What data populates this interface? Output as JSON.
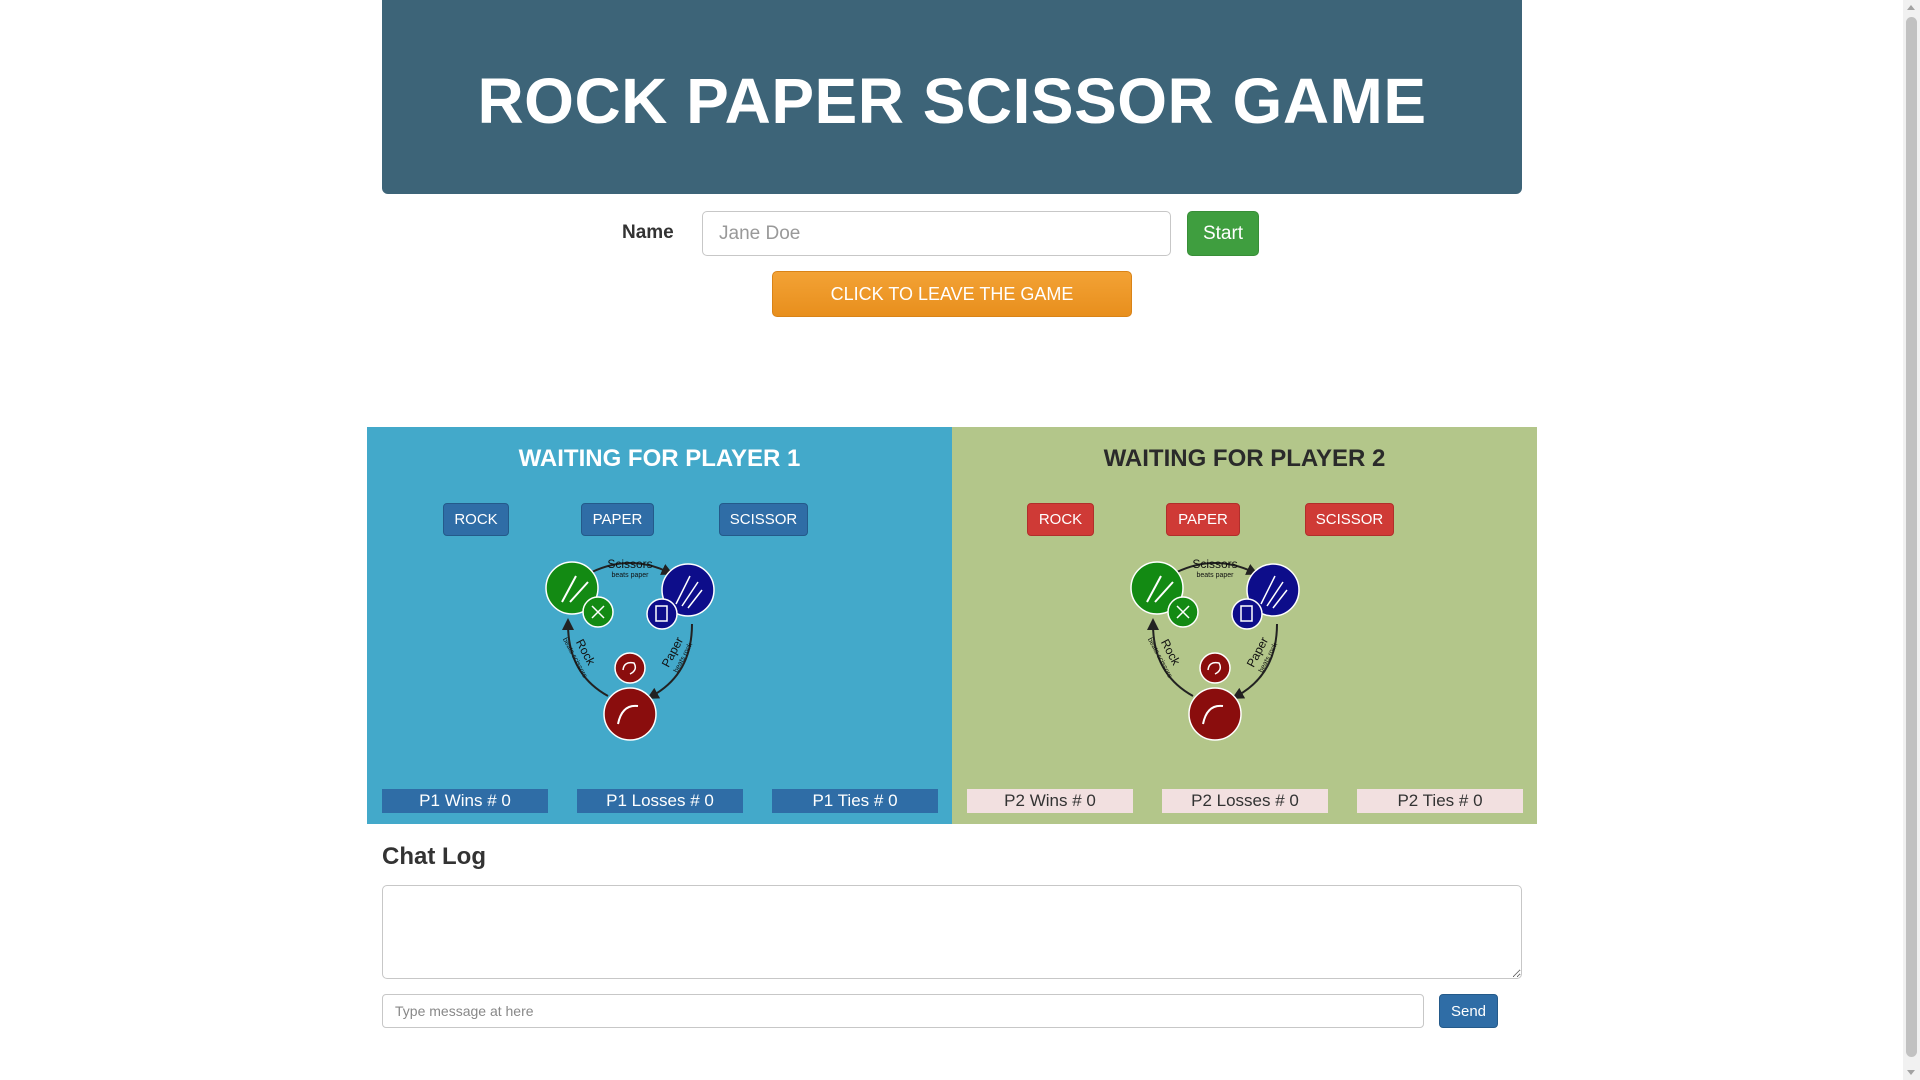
{
  "header": {
    "title": "ROCK PAPER SCISSOR GAME"
  },
  "join": {
    "name_label": "Name",
    "name_placeholder": "Jane Doe",
    "start_label": "Start",
    "leave_label": "CLICK TO LEAVE THE GAME"
  },
  "player1": {
    "title": "WAITING FOR PLAYER 1",
    "buttons": {
      "rock": "ROCK",
      "paper": "PAPER",
      "scissor": "SCISSOR"
    },
    "stats": {
      "wins": "P1 Wins # 0",
      "losses": "P1 Losses # 0",
      "ties": "P1 Ties # 0"
    },
    "color": "#43a9ca"
  },
  "player2": {
    "title": "WAITING FOR PLAYER 2",
    "buttons": {
      "rock": "ROCK",
      "paper": "PAPER",
      "scissor": "SCISSOR"
    },
    "stats": {
      "wins": "P2 Wins # 0",
      "losses": "P2 Losses # 0",
      "ties": "P2 Ties # 0"
    },
    "color": "#b3c68a"
  },
  "diagram": {
    "scissors_title": "Scissors",
    "scissors_sub": "beats paper",
    "rock_title": "Rock",
    "rock_sub": "beats scissors",
    "paper_title": "Paper",
    "paper_sub": "beats rock"
  },
  "chat": {
    "title": "Chat Log",
    "log_value": "",
    "message_placeholder": "Type message at here",
    "send_label": "Send"
  }
}
